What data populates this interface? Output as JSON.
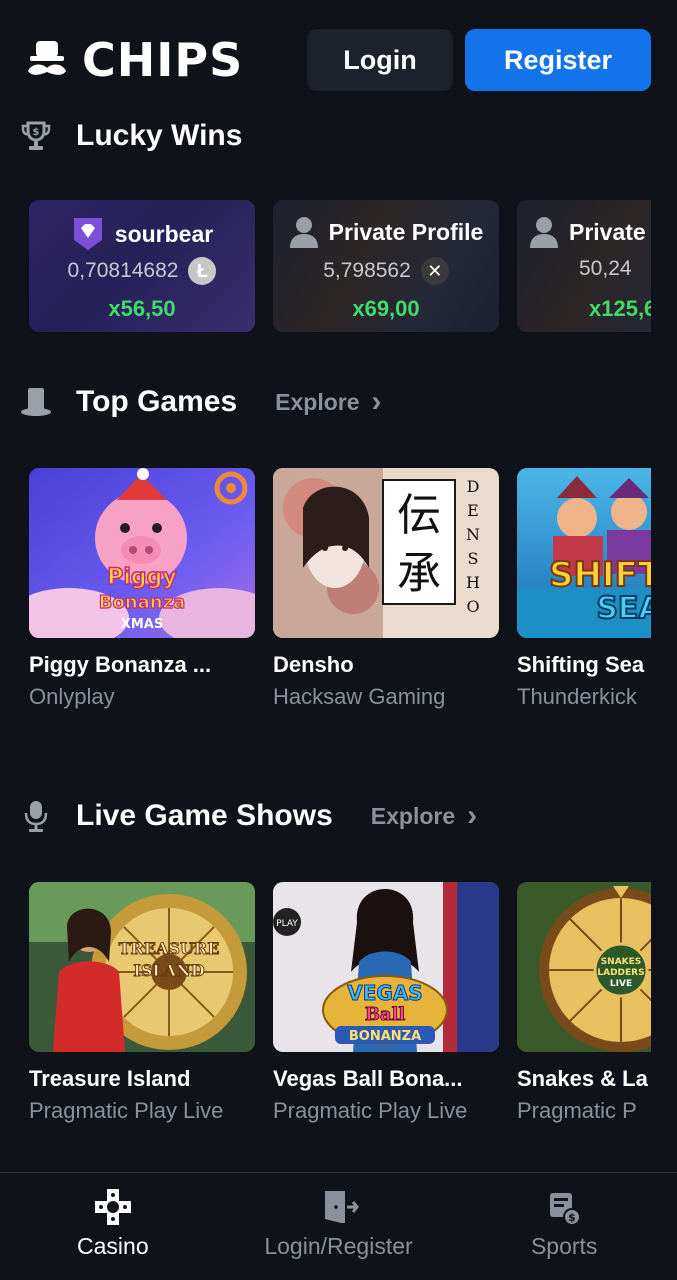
{
  "header": {
    "logo_text": "CHIPS",
    "login_label": "Login",
    "register_label": "Register"
  },
  "lucky_wins": {
    "title": "Lucky Wins",
    "cards": [
      {
        "user": "sourbear",
        "amount": "0,70814682",
        "coin": "Ł",
        "multiplier": "x56,50"
      },
      {
        "user": "Private Profile",
        "amount": "5,798562",
        "coin": "✕",
        "multiplier": "x69,00"
      },
      {
        "user": "Private Profile",
        "amount": "50,24",
        "coin": "",
        "multiplier": "x125,6"
      }
    ]
  },
  "top_games": {
    "title": "Top Games",
    "explore_label": "Explore",
    "games": [
      {
        "name": "Piggy Bonanza ...",
        "provider": "Onlyplay",
        "art_text": "Piggy Bonanza XMAS"
      },
      {
        "name": "Densho",
        "provider": "Hacksaw Gaming",
        "art_text": "DENSHO"
      },
      {
        "name": "Shifting Sea",
        "provider": "Thunderkick",
        "art_text": "SHIFT SEA"
      }
    ]
  },
  "live_game_shows": {
    "title": "Live Game Shows",
    "explore_label": "Explore",
    "games": [
      {
        "name": "Treasure Island",
        "provider": "Pragmatic Play Live",
        "art_text": "TREASURE ISLAND"
      },
      {
        "name": "Vegas Ball Bona...",
        "provider": "Pragmatic Play Live",
        "art_text": "Vegas Ball BONANZA"
      },
      {
        "name": "Snakes & La",
        "provider": "Pragmatic P",
        "art_text": "SNAKES LADDERS LIVE"
      }
    ]
  },
  "bottom_nav": {
    "items": [
      {
        "label": "Casino",
        "active": true
      },
      {
        "label": "Login/Register",
        "active": false
      },
      {
        "label": "Sports",
        "active": false
      }
    ]
  },
  "colors": {
    "background": "#0f1218",
    "accent": "#1273ea",
    "win_green": "#3fdc6a",
    "muted": "#8a919c"
  }
}
